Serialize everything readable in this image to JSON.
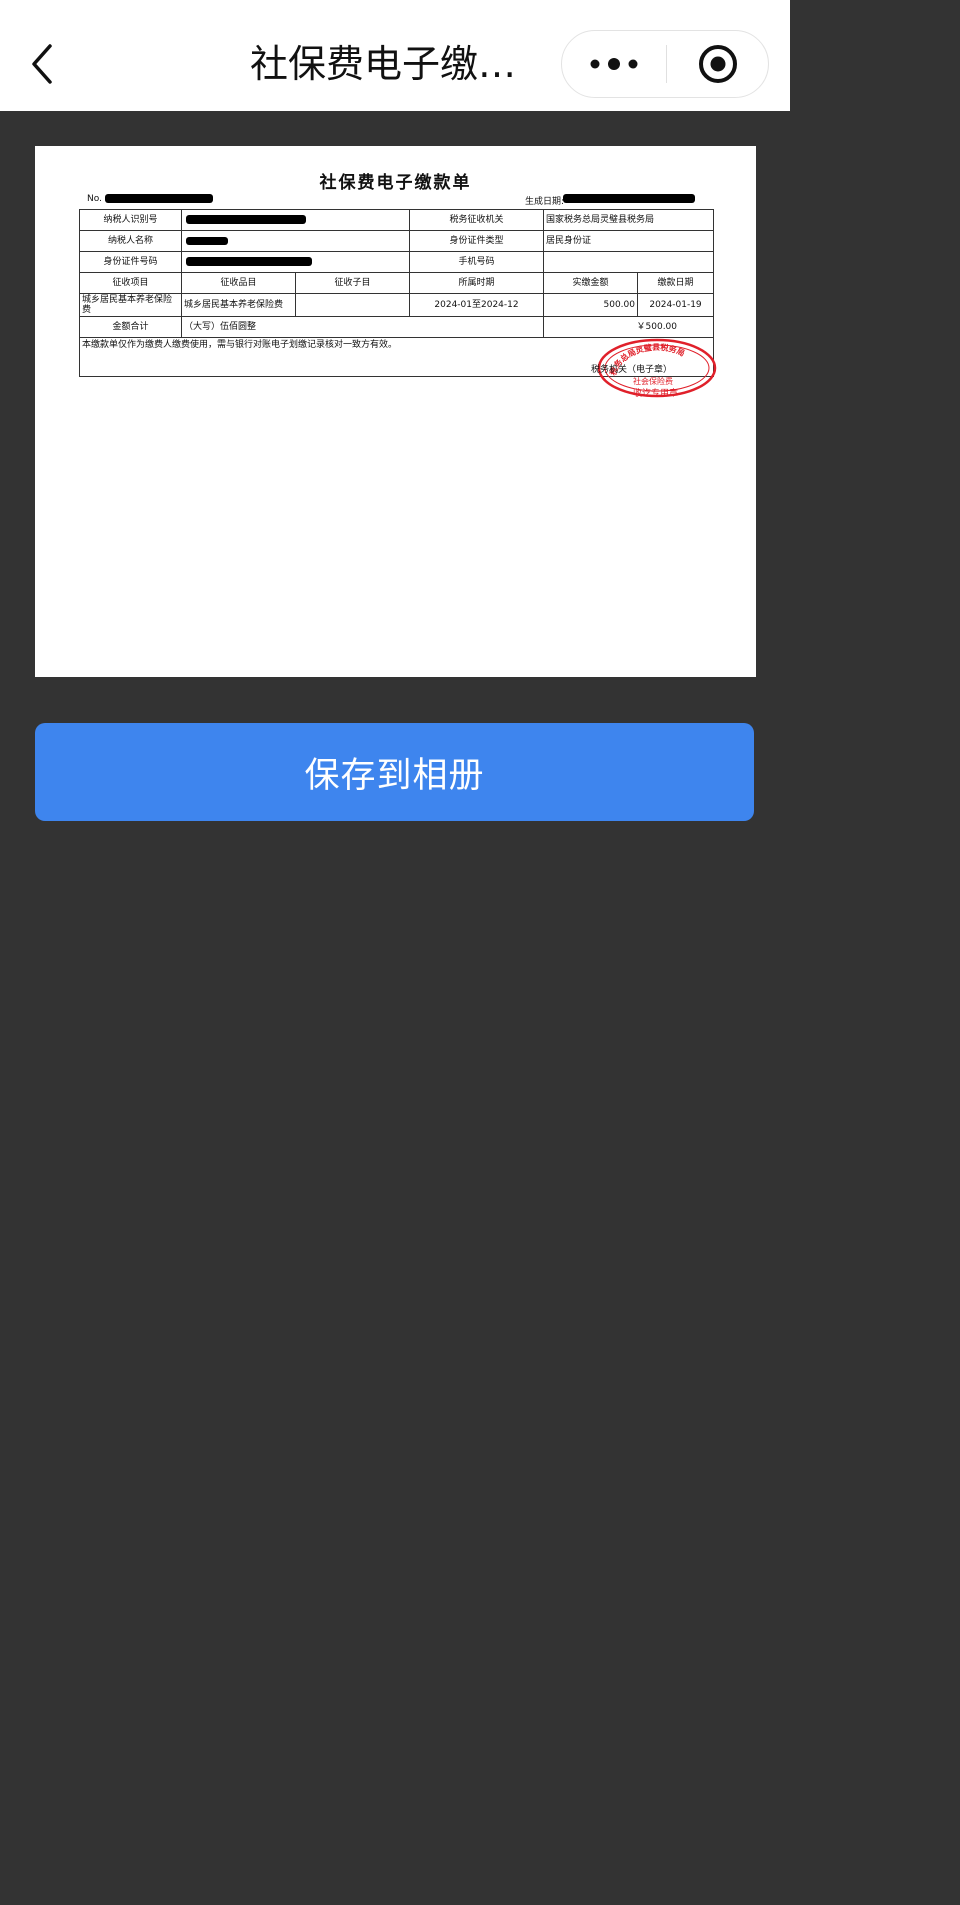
{
  "header": {
    "title": "社保费电子缴…",
    "back_icon": "chevron-left-icon",
    "more_icon": "more-dots-icon",
    "close_icon": "target-circle-icon"
  },
  "receipt": {
    "title": "社保费电子缴款单",
    "no_label": "No.",
    "date_label": "生成日期:",
    "rows": {
      "taxpayer_id_label": "纳税人识别号",
      "tax_office_label": "税务征收机关",
      "tax_office_value": "国家税务总局灵璧县税务局",
      "taxpayer_name_label": "纳税人名称",
      "id_type_label": "身份证件类型",
      "id_type_value": "居民身份证",
      "id_number_label": "身份证件号码",
      "phone_label": "手机号码"
    },
    "columns": [
      "征收项目",
      "征收品目",
      "征收子目",
      "所属时期",
      "实缴金额",
      "缴款日期"
    ],
    "item": {
      "project": "城乡居民基本养老保险费",
      "category": "城乡居民基本养老保险费",
      "sub": "",
      "period": "2024-01至2024-12",
      "amount": "500.00",
      "date": "2024-01-19"
    },
    "total_label": "金额合计",
    "total_words": "（大写）伍佰圆整",
    "total_amount": "￥500.00",
    "note": "本缴款单仅作为缴费人缴费使用，需与银行对账电子划缴记录核对一致方有效。",
    "stamp_label": "税务机关（电子章）",
    "stamp_text_top": "税务总局灵璧县税务局",
    "stamp_text_mid": "社会保险费",
    "stamp_text_bottom": "收讫专用章"
  },
  "colors": {
    "button_blue": "#3e85ee",
    "background": "#333333",
    "stamp_red": "#e0202a"
  },
  "save_button": {
    "label": "保存到相册"
  }
}
